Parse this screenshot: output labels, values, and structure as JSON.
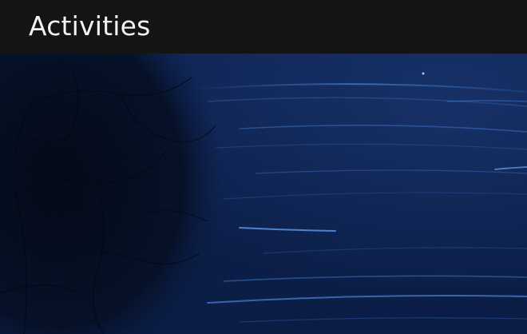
{
  "topbar": {
    "activities_label": "Activities"
  },
  "wallpaper": {
    "description_name": "star-trails-night-sky",
    "colors": {
      "sky": "#0f2352",
      "trail": "#3f78c7",
      "trail_bright": "#7fb0ff",
      "tree": "#050b1c"
    }
  }
}
